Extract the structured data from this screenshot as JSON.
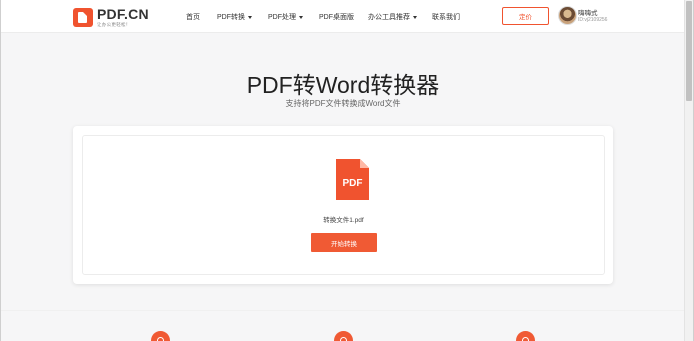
{
  "header": {
    "logo": {
      "name": "PDF.CN",
      "slogan": "让办公更轻松！"
    },
    "nav": [
      {
        "label": "首页",
        "has_dropdown": false
      },
      {
        "label": "PDF转换",
        "has_dropdown": true
      },
      {
        "label": "PDF处理",
        "has_dropdown": true
      },
      {
        "label": "PDF桌面版",
        "has_dropdown": false
      },
      {
        "label": "办公工具推荐",
        "has_dropdown": true
      },
      {
        "label": "联系我们",
        "has_dropdown": false
      }
    ],
    "pricing_label": "定价",
    "user": {
      "name": "嗨嗨式",
      "id": "ID:vj2109256"
    }
  },
  "hero": {
    "title": "PDF转Word转换器",
    "subtitle": "支持将PDF文件转换成Word文件"
  },
  "converter": {
    "file_icon_label": "PDF",
    "file_name": "转换文件1.pdf",
    "convert_button": "开始转换"
  },
  "colors": {
    "accent": "#f05a34",
    "header_bg": "#ffffff",
    "page_bg": "#f6f6f7"
  },
  "icons": [
    "logo-icon",
    "pdf-file-icon",
    "feature-icon"
  ]
}
